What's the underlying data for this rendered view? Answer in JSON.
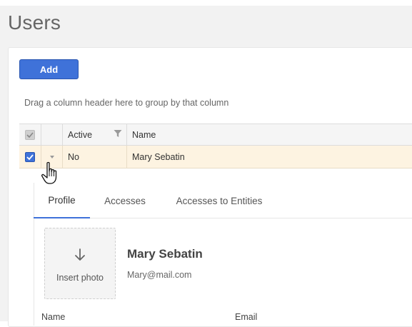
{
  "page": {
    "title": "Users"
  },
  "toolbar": {
    "add_label": "Add"
  },
  "grid": {
    "group_hint": "Drag a column header here to group by that column",
    "columns": {
      "active": "Active",
      "name": "Name"
    },
    "rows": [
      {
        "selected": true,
        "active": "No",
        "name": "Mary Sebatin"
      }
    ]
  },
  "detail": {
    "tabs": [
      {
        "label": "Profile",
        "active": true
      },
      {
        "label": "Accesses",
        "active": false
      },
      {
        "label": "Accesses to Entities",
        "active": false
      }
    ],
    "photo": {
      "label": "Insert photo",
      "icon": "arrow-down-icon"
    },
    "user": {
      "name": "Mary Sebatin",
      "email": "Mary@mail.com"
    },
    "fields": {
      "name_label": "Name",
      "email_label": "Email"
    }
  },
  "colors": {
    "accent": "#3f72d9",
    "row_highlight": "#fdf3e1"
  }
}
